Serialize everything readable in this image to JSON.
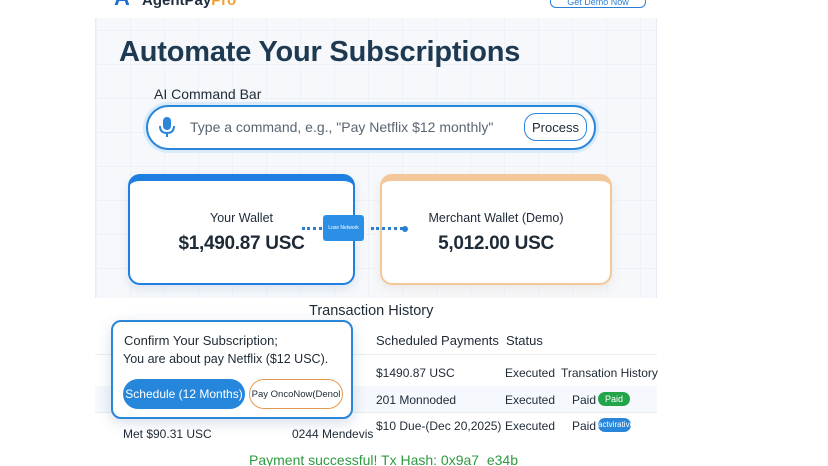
{
  "header": {
    "logo_text": "AgentPay",
    "logo_accent": "Pro",
    "top_button_label": "Get Demo Now"
  },
  "headline": "Automate Your Subscriptions",
  "command_bar": {
    "label": "AI Command Bar",
    "placeholder": "Type a command, e.g., \"Pay Netflix $12 monthly\"",
    "process_label": "Process"
  },
  "wallets": {
    "user": {
      "title": "Your Wallet",
      "amount": "$1,490.87 USC"
    },
    "merchant": {
      "title": "Merchant Wallet (Demo)",
      "amount": "5,012.00 USC"
    },
    "network_label": "Lose Network"
  },
  "history": {
    "title": "Transaction History",
    "columns": [
      "Scheduled Payments",
      "Status"
    ],
    "rows": [
      {
        "payment": "$1490.87 USC",
        "status": "Executed",
        "extra": "Transation History",
        "badge": ""
      },
      {
        "payment": "201 Monnoded",
        "status": "Executed",
        "extra": "Paid",
        "badge": "Paid"
      },
      {
        "left": "Met $90.31 USC",
        "mid": "0244 Mendevis",
        "payment": "$10 Due-(Dec 20,2025)",
        "status": "Executed",
        "extra": "Paid",
        "badge": "actvirative"
      }
    ]
  },
  "confirm": {
    "title": "Confirm Your Subscription;",
    "body": "You are about pay Netflix ($12 USC).",
    "schedule_label": "Schedule (12 Months)",
    "payonce_label": "Pay OncoNow(Denol"
  },
  "success_message": "Payment successful! Tx Hash: 0x9a7_e34b",
  "colors": {
    "primary": "#2a86d9",
    "accent": "#f0a030",
    "success": "#22a44a"
  }
}
